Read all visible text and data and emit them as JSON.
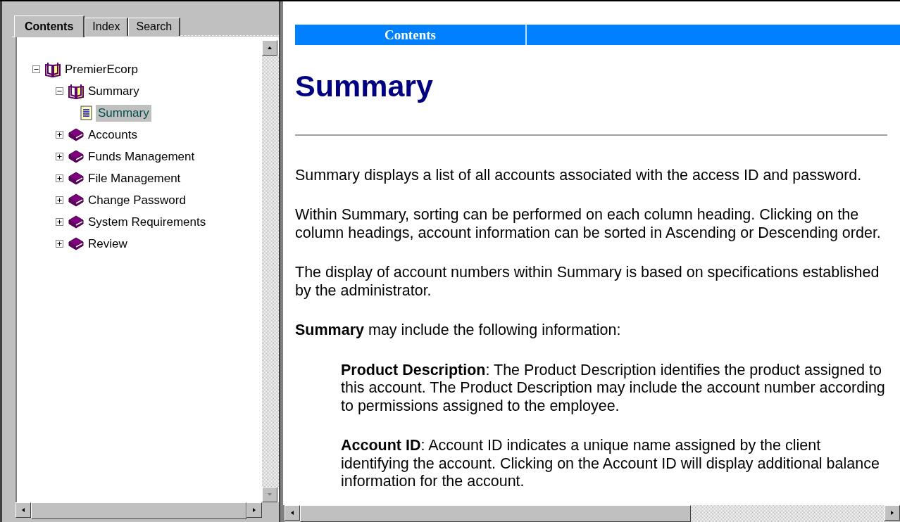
{
  "tabs": [
    {
      "label": "Contents",
      "selected": true
    },
    {
      "label": "Index",
      "selected": false
    },
    {
      "label": "Search",
      "selected": false
    }
  ],
  "tree": [
    {
      "label": "PremierEcorp",
      "kind": "book",
      "expanded": true,
      "selected": false,
      "children": [
        {
          "label": "Summary",
          "kind": "book",
          "expanded": true,
          "selected": false,
          "children": [
            {
              "label": "Summary",
              "kind": "page",
              "selected": true
            }
          ]
        },
        {
          "label": "Accounts",
          "kind": "book",
          "expanded": false,
          "selected": false
        },
        {
          "label": "Funds Management",
          "kind": "book",
          "expanded": false,
          "selected": false
        },
        {
          "label": "File Management",
          "kind": "book",
          "expanded": false,
          "selected": false
        },
        {
          "label": "Change Password",
          "kind": "book",
          "expanded": false,
          "selected": false
        },
        {
          "label": "System Requirements",
          "kind": "book",
          "expanded": false,
          "selected": false
        },
        {
          "label": "Review",
          "kind": "book",
          "expanded": false,
          "selected": false
        }
      ]
    }
  ],
  "nav_bar": {
    "label": "Contents"
  },
  "title": "Summary",
  "paragraphs": [
    {
      "kind": "body",
      "text": "Summary displays a list of all accounts associated with the access ID and password."
    },
    {
      "kind": "body",
      "text": "Within Summary, sorting can be performed on each column heading. Clicking on the column headings, account information can be sorted in Ascending or Descending order."
    },
    {
      "kind": "body",
      "text": "The display of account numbers within Summary is based on specifications established by the administrator."
    },
    {
      "kind": "body",
      "text": "**Summary** may include the following information:"
    },
    {
      "kind": "definition",
      "text": "**Product Description**: The Product Description identifies the product assigned to this account. The Product Description may include the account number according to permissions assigned to the employee."
    },
    {
      "kind": "definition",
      "text": "**Account ID**: Account ID indicates a unique name assigned by the client identifying the account. Clicking on the Account ID will display additional balance information for the account."
    }
  ]
}
